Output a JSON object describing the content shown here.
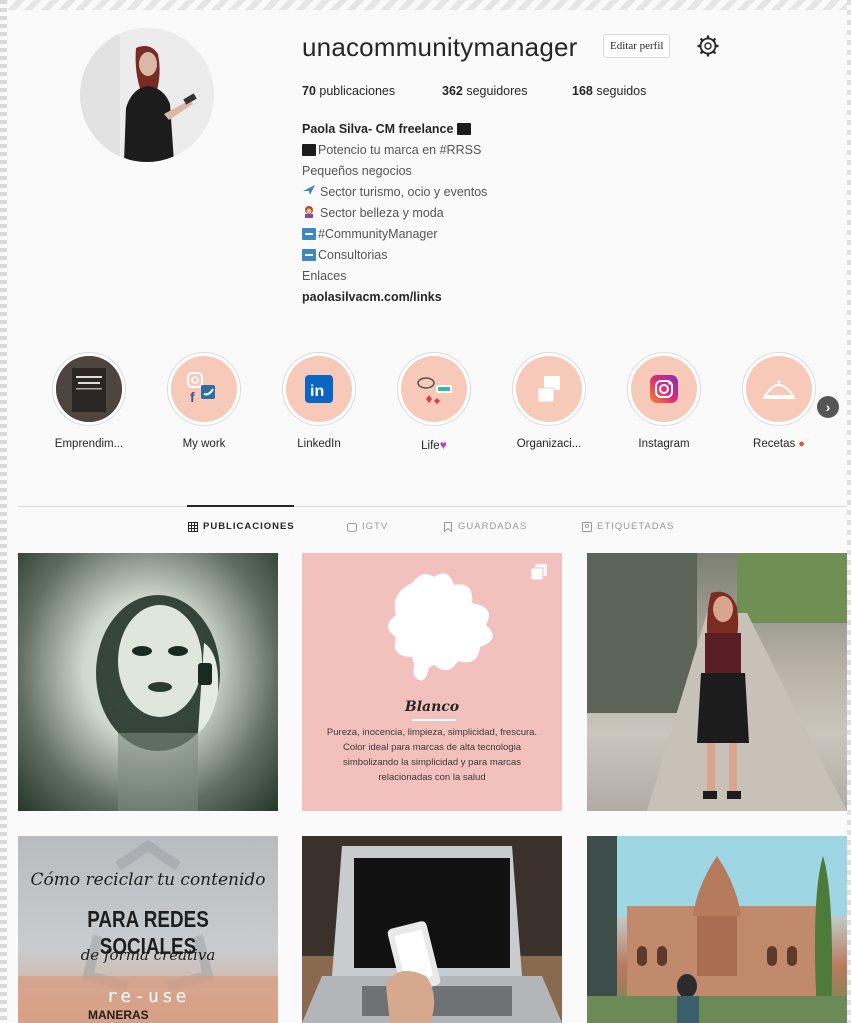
{
  "profile": {
    "username": "unacommunitymanager",
    "edit_button": "Editar perfil",
    "settings_icon": "gear-icon"
  },
  "stats": {
    "posts_count": "70",
    "posts_label": "publicaciones",
    "followers_count": "362",
    "followers_label": "seguidores",
    "following_count": "168",
    "following_label": "seguidos"
  },
  "bio": {
    "name": "Paola Silva- CM freelance",
    "lines": [
      "Potencio tu marca en #RRSS",
      "Pequeños negocios",
      "Sector turismo, ocio y eventos",
      "Sector belleza y moda",
      "#CommunityManager",
      " Consultorias",
      "Enlaces"
    ],
    "link": "paolasilvacm.com/links"
  },
  "highlights": [
    {
      "label": "Emprendim..."
    },
    {
      "label": "My work"
    },
    {
      "label": "LinkedIn"
    },
    {
      "label": "Life"
    },
    {
      "label": "Organizaci..."
    },
    {
      "label": "Instagram"
    },
    {
      "label": "Recetas"
    }
  ],
  "tabs": [
    {
      "label": "PUBLICACIONES",
      "icon": "grid-icon",
      "active": true
    },
    {
      "label": "IGTV",
      "icon": "igtv-icon",
      "active": false
    },
    {
      "label": "GUARDADAS",
      "icon": "bookmark-icon",
      "active": false
    },
    {
      "label": "ETIQUETADAS",
      "icon": "tagged-icon",
      "active": false
    }
  ],
  "posts": {
    "blanco_title": "Blanco",
    "blanco_text": "Pureza, inocencia, limpieza, simplicidad, frescura. Color ideal para marcas de alta tecnologia simbolizando la simplicidad y para marcas relacionadas con la salud",
    "reciclar_line1": "Cómo reciclar tu contenido",
    "reciclar_line2": "PARA REDES SOCIALES",
    "reciclar_line3": "de forma creativa",
    "reciclar_line4": "re-use",
    "reciclar_line5": "MANERAS"
  },
  "colors": {
    "highlight_bg": "#f7c9b8",
    "blanco_bg": "#f2c1bd",
    "text_primary": "#262626",
    "text_secondary": "#555555"
  }
}
